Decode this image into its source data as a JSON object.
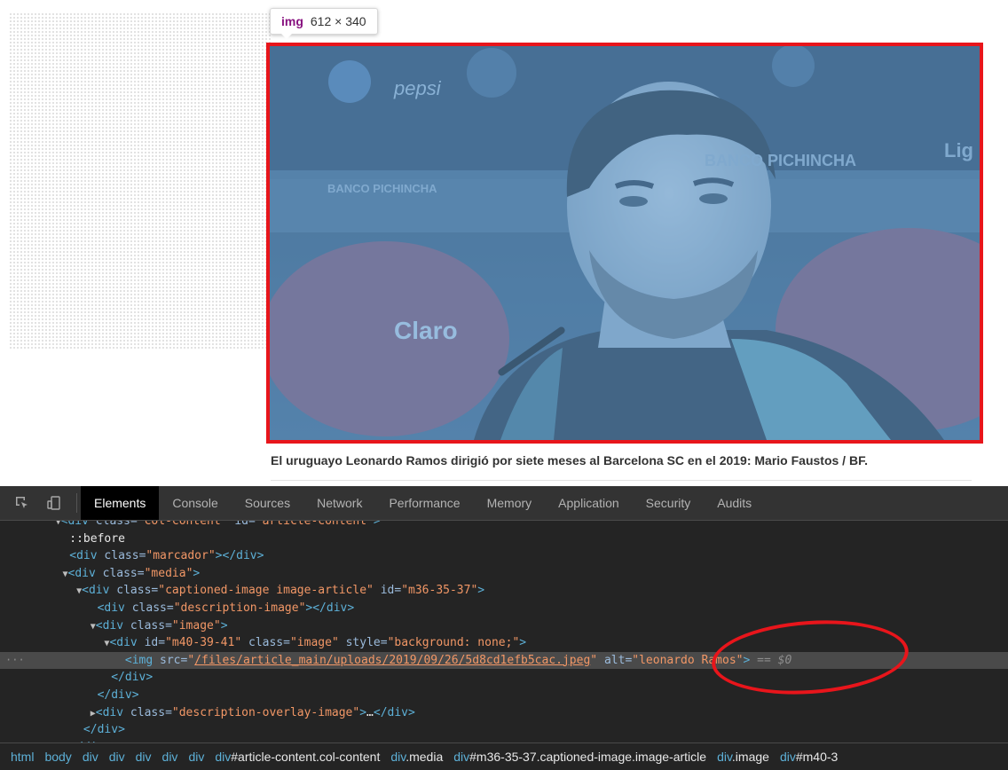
{
  "tooltip": {
    "tag": "img",
    "size": "612 × 340"
  },
  "photo": {
    "sponsors": [
      "pepsi",
      "BANCO PICHINCHA",
      "BANCO PICHINCHA",
      "Claro",
      "Lig"
    ]
  },
  "caption": "El uruguayo Leonardo Ramos dirigió por siete meses al Barcelona SC en el 2019: Mario Faustos / BF.",
  "devtools": {
    "tabs": [
      "Elements",
      "Console",
      "Sources",
      "Network",
      "Performance",
      "Memory",
      "Application",
      "Security",
      "Audits"
    ],
    "tree": {
      "l0": {
        "tag": "div",
        "attr1": "class",
        "val1": "col-content",
        "attr2": "id",
        "val2": "article-content"
      },
      "l1": "::before",
      "l2": {
        "tag": "div",
        "attr": "class",
        "val": "marcador"
      },
      "l3": {
        "tag": "div",
        "attr": "class",
        "val": "media"
      },
      "l4": {
        "tag": "div",
        "attr1": "class",
        "val1": "captioned-image image-article",
        "attr2": "id",
        "val2": "m36-35-37"
      },
      "l5": {
        "tag": "div",
        "attr": "class",
        "val": "description-image"
      },
      "l6": {
        "tag": "div",
        "attr": "class",
        "val": "image"
      },
      "l7": {
        "tag": "div",
        "attr1": "id",
        "val1": "m40-39-41",
        "attr2": "class",
        "val2": "image",
        "attr3": "style",
        "val3": "background: none;"
      },
      "l8": {
        "tag": "img",
        "attr1": "src",
        "val1": "/files/article_main/uploads/2019/09/26/5d8cd1efb5cac.jpeg",
        "attr2": "alt",
        "val2": "leonardo Ramos",
        "marker": "== $0"
      },
      "l9": "div",
      "l10": "div",
      "l11": {
        "tag": "div",
        "attr": "class",
        "val": "description-overlay-image",
        "ellipsis": "…"
      },
      "l12": "div",
      "l13": "div"
    },
    "breadcrumbs": [
      {
        "tag": "html",
        "id": ""
      },
      {
        "tag": "body",
        "id": ""
      },
      {
        "tag": "div",
        "id": ""
      },
      {
        "tag": "div",
        "id": ""
      },
      {
        "tag": "div",
        "id": ""
      },
      {
        "tag": "div",
        "id": ""
      },
      {
        "tag": "div",
        "id": ""
      },
      {
        "tag": "div",
        "id": "#article-content.col-content"
      },
      {
        "tag": "div",
        "id": ".media"
      },
      {
        "tag": "div",
        "id": "#m36-35-37.captioned-image.image-article"
      },
      {
        "tag": "div",
        "id": ".image"
      },
      {
        "tag": "div",
        "id": "#m40-3"
      }
    ]
  },
  "colors": {
    "highlight": "#e8151b",
    "overlay": "#6fa8dc",
    "devtools_bg": "#242424"
  }
}
